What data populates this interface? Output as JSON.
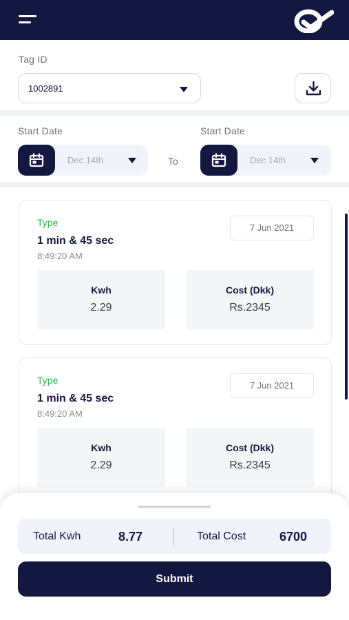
{
  "header": {
    "menu_icon": "hamburger-menu-icon",
    "logo_icon": "brand-logo-icon",
    "color": "#14173f"
  },
  "filters": {
    "tag_id_label": "Tag ID",
    "tag_id_value": "1002891",
    "download_icon": "download-icon",
    "start_date_label_1": "Start Date",
    "start_date_label_2": "Start Date",
    "start_date_value": "Dec 14th",
    "end_date_value": "Dec 14th",
    "to_label": "To"
  },
  "sessions": [
    {
      "type": "Type",
      "duration": "1 min & 45 sec",
      "time": "8:49:20 AM",
      "date": "7 Jun 2021",
      "kwh_label": "Kwh",
      "kwh_value": "2.29",
      "cost_label": "Cost (Dkk)",
      "cost_value": "Rs.2345"
    },
    {
      "type": "Type",
      "duration": "1 min & 45 sec",
      "time": "8:49:20 AM",
      "date": "7 Jun 2021",
      "kwh_label": "Kwh",
      "kwh_value": "2.29",
      "cost_label": "Cost (Dkk)",
      "cost_value": "Rs.2345"
    }
  ],
  "summary": {
    "total_kwh_label": "Total Kwh",
    "total_kwh_value": "8.77",
    "total_cost_label": "Total Cost",
    "total_cost_value": "6700",
    "submit_label": "Submit"
  },
  "colors": {
    "primary": "#14173f",
    "accent_green": "#2bb34a",
    "surface": "#f1f3fa"
  }
}
